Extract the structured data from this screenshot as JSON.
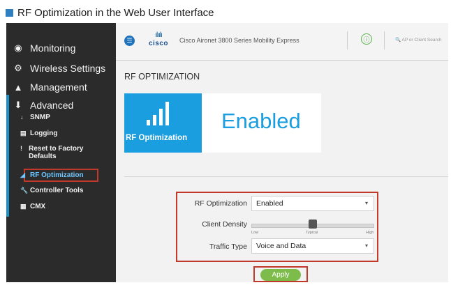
{
  "caption": {
    "text": "RF Optimization in the Web User Interface"
  },
  "sidebar": {
    "items": [
      {
        "icon": "dashboard-icon",
        "label": "Monitoring"
      },
      {
        "icon": "gear-icon",
        "label": "Wireless Settings"
      },
      {
        "icon": "management-icon",
        "label": "Management"
      },
      {
        "icon": "download-icon",
        "label": "Advanced"
      }
    ],
    "subitems": [
      {
        "icon": "download-arrow-icon",
        "label": "SNMP"
      },
      {
        "icon": "log-file-icon",
        "label": "Logging"
      },
      {
        "icon": "exclamation-icon",
        "label": "Reset to Factory Defaults"
      },
      {
        "icon": "signal-bars-icon",
        "label": "RF Optimization",
        "active": true
      },
      {
        "icon": "wrench-icon",
        "label": "Controller Tools"
      },
      {
        "icon": "cmx-icon",
        "label": "CMX"
      }
    ]
  },
  "header": {
    "logo_text": "cisco",
    "product": "Cisco Aironet 3800 Series Mobility Express",
    "search_placeholder": "AP or Client Search"
  },
  "main": {
    "title": "RF OPTIMIZATION",
    "tile_label": "RF Optimization",
    "tile_status": "Enabled",
    "form": {
      "rf_label": "RF Optimization",
      "rf_value": "Enabled",
      "density_label": "Client Density",
      "density_value": 0.5,
      "density_ticks": [
        "Low",
        "Typical",
        "High"
      ],
      "traffic_label": "Traffic Type",
      "traffic_value": "Voice and Data"
    },
    "apply_label": "Apply"
  },
  "colors": {
    "accent_blue": "#1b9ee0",
    "sidebar_bg": "#2b2b2b",
    "highlight_red": "#c0392b",
    "apply_green": "#7dbb4b"
  }
}
